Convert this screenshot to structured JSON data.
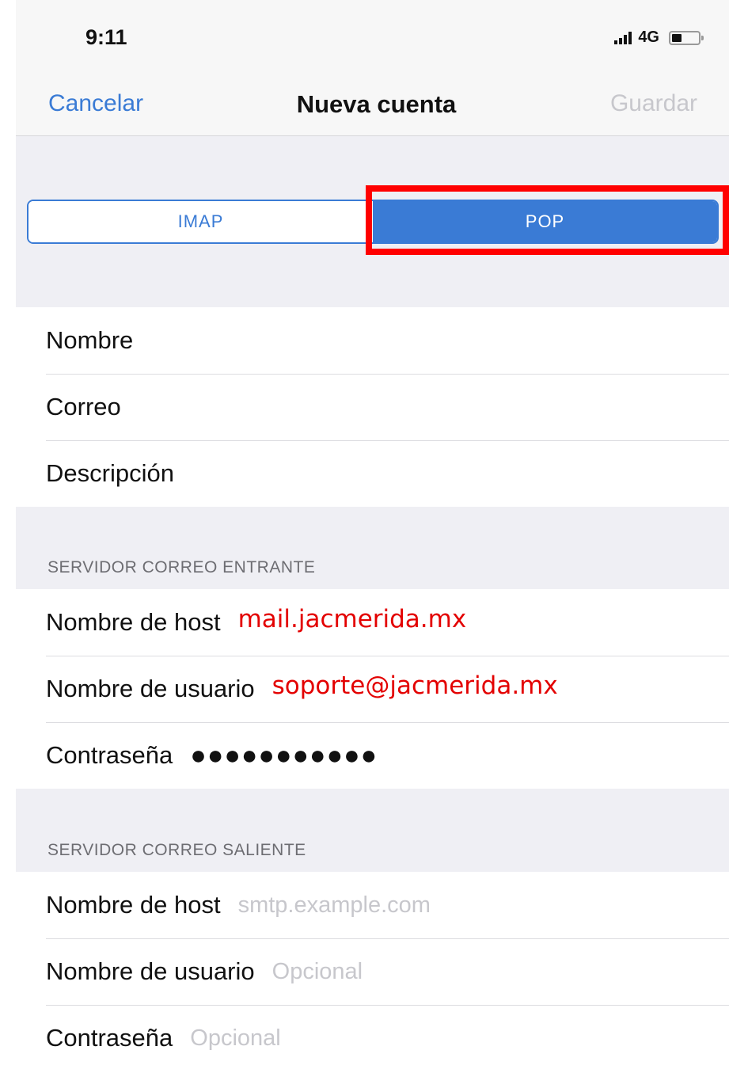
{
  "status_bar": {
    "time": "9:11",
    "network": "4G",
    "signal_icon": "signal-bars-icon",
    "battery_icon": "battery-icon"
  },
  "nav": {
    "cancel": "Cancelar",
    "title": "Nueva cuenta",
    "save": "Guardar"
  },
  "segmented": {
    "options": [
      "IMAP",
      "POP"
    ],
    "selected": "POP",
    "accent_color": "#3a7bd5",
    "highlight_color": "#ff0000"
  },
  "account": {
    "rows": [
      {
        "label": "Nombre",
        "value": ""
      },
      {
        "label": "Correo",
        "value": ""
      },
      {
        "label": "Descripción",
        "value": ""
      }
    ]
  },
  "incoming": {
    "header": "SERVIDOR CORREO ENTRANTE",
    "host_label": "Nombre de host",
    "host_value": "mail.jacmerida.mx",
    "user_label": "Nombre de usuario",
    "user_value": "soporte@jacmerida.mx",
    "password_label": "Contraseña",
    "password_value": "●●●●●●●●●●●"
  },
  "outgoing": {
    "header": "SERVIDOR CORREO SALIENTE",
    "host_label": "Nombre de host",
    "host_placeholder": "smtp.example.com",
    "user_label": "Nombre de usuario",
    "user_placeholder": "Opcional",
    "password_label": "Contraseña",
    "password_placeholder": "Opcional"
  }
}
